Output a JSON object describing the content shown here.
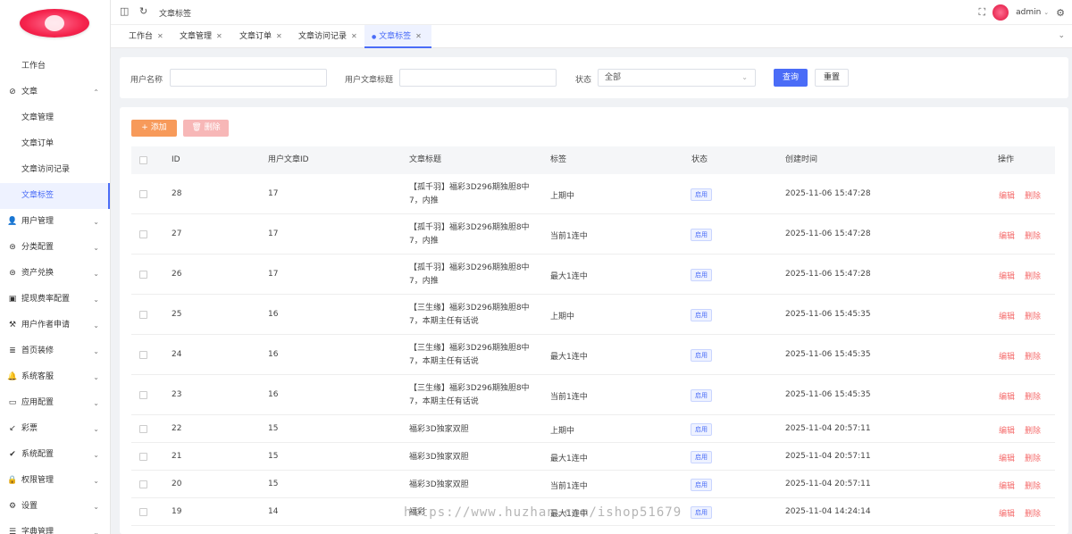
{
  "sidebar": {
    "items": [
      {
        "label": "工作台",
        "icon": "",
        "type": "child"
      },
      {
        "label": "文章",
        "icon": "compass-icon",
        "type": "parent",
        "chevron": "up"
      },
      {
        "label": "文章管理",
        "icon": "",
        "type": "child"
      },
      {
        "label": "文章订单",
        "icon": "",
        "type": "child"
      },
      {
        "label": "文章访问记录",
        "icon": "",
        "type": "child"
      },
      {
        "label": "文章标签",
        "icon": "",
        "type": "child",
        "active": true
      },
      {
        "label": "用户管理",
        "icon": "user-icon",
        "type": "parent",
        "chevron": "down"
      },
      {
        "label": "分类配置",
        "icon": "database-icon",
        "type": "parent",
        "chevron": "down"
      },
      {
        "label": "资产兑换",
        "icon": "database-icon",
        "type": "parent",
        "chevron": "down"
      },
      {
        "label": "提现费率配置",
        "icon": "camera-icon",
        "type": "parent",
        "chevron": "down"
      },
      {
        "label": "用户作者申请",
        "icon": "hammer-icon",
        "type": "parent",
        "chevron": "down"
      },
      {
        "label": "首页装修",
        "icon": "list-icon",
        "type": "parent",
        "chevron": "down"
      },
      {
        "label": "系统客服",
        "icon": "bell-icon",
        "type": "parent",
        "chevron": "down"
      },
      {
        "label": "应用配置",
        "icon": "card-icon",
        "type": "parent",
        "chevron": "down"
      },
      {
        "label": "彩票",
        "icon": "arrow-down-left-icon",
        "type": "parent",
        "chevron": "down"
      },
      {
        "label": "系统配置",
        "icon": "check-circle-icon",
        "type": "parent",
        "chevron": "down"
      },
      {
        "label": "权限管理",
        "icon": "lock-icon",
        "type": "parent",
        "chevron": "down"
      },
      {
        "label": "设置",
        "icon": "gear-icon",
        "type": "parent",
        "chevron": "down"
      },
      {
        "label": "字典管理",
        "icon": "book-icon",
        "type": "parent",
        "chevron": "down"
      }
    ]
  },
  "topbar": {
    "breadcrumb": "文章标签",
    "username": "admin"
  },
  "tabs": [
    {
      "label": "工作台"
    },
    {
      "label": "文章管理"
    },
    {
      "label": "文章订单"
    },
    {
      "label": "文章访问记录"
    },
    {
      "label": "文章标签",
      "active": true
    }
  ],
  "filter": {
    "user_name_label": "用户名称",
    "user_name_value": "",
    "article_title_label": "用户文章标题",
    "article_title_value": "",
    "status_label": "状态",
    "status_value": "全部",
    "search_label": "查询",
    "reset_label": "重置"
  },
  "toolbar": {
    "add_label": "添加",
    "delete_label": "删除"
  },
  "table": {
    "headers": [
      "ID",
      "用户文章ID",
      "文章标题",
      "标签",
      "状态",
      "创建时间",
      "操作"
    ],
    "rows": [
      {
        "id": "28",
        "article_id": "17",
        "title": "【孤千羽】福彩3D296期独胆8中7，内推",
        "tag": "上期中",
        "status": "启用",
        "created": "2025-11-06 15:47:28"
      },
      {
        "id": "27",
        "article_id": "17",
        "title": "【孤千羽】福彩3D296期独胆8中7，内推",
        "tag": "当前1连中",
        "status": "启用",
        "created": "2025-11-06 15:47:28"
      },
      {
        "id": "26",
        "article_id": "17",
        "title": "【孤千羽】福彩3D296期独胆8中7，内推",
        "tag": "最大1连中",
        "status": "启用",
        "created": "2025-11-06 15:47:28"
      },
      {
        "id": "25",
        "article_id": "16",
        "title": "【三生缘】福彩3D296期独胆8中7，本期主任有话说",
        "tag": "上期中",
        "status": "启用",
        "created": "2025-11-06 15:45:35"
      },
      {
        "id": "24",
        "article_id": "16",
        "title": "【三生缘】福彩3D296期独胆8中7，本期主任有话说",
        "tag": "最大1连中",
        "status": "启用",
        "created": "2025-11-06 15:45:35"
      },
      {
        "id": "23",
        "article_id": "16",
        "title": "【三生缘】福彩3D296期独胆8中7，本期主任有话说",
        "tag": "当前1连中",
        "status": "启用",
        "created": "2025-11-06 15:45:35"
      },
      {
        "id": "22",
        "article_id": "15",
        "title": "福彩3D独家双胆",
        "tag": "上期中",
        "status": "启用",
        "created": "2025-11-04 20:57:11"
      },
      {
        "id": "21",
        "article_id": "15",
        "title": "福彩3D独家双胆",
        "tag": "最大1连中",
        "status": "启用",
        "created": "2025-11-04 20:57:11"
      },
      {
        "id": "20",
        "article_id": "15",
        "title": "福彩3D独家双胆",
        "tag": "当前1连中",
        "status": "启用",
        "created": "2025-11-04 20:57:11"
      },
      {
        "id": "19",
        "article_id": "14",
        "title": "福彩",
        "tag": "最大1连中",
        "status": "启用",
        "created": "2025-11-04 14:24:14"
      }
    ],
    "edit_label": "编辑",
    "delete_label": "删除"
  },
  "watermark": "https://www.huzhan.com/ishop51679",
  "colors": {
    "accent": "#4a6cf7",
    "add": "#f79a5a",
    "danger": "#f56c6c"
  }
}
